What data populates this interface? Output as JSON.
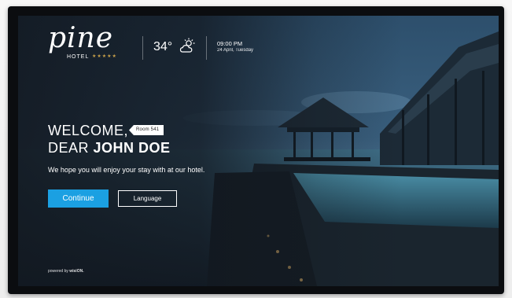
{
  "header": {
    "logo_word": "pine",
    "logo_sub": "HOTEL",
    "logo_stars": "★★★★★",
    "temperature": "34°",
    "weather_icon": "partly-cloudy-icon",
    "time": "09:00 PM",
    "date": "24 April, Tuesday"
  },
  "welcome": {
    "line1": "WELCOME,",
    "line2_prefix": "DEAR ",
    "guest_name": "JOHN DOE",
    "room_tag": "Room 541",
    "message": "We hope you will enjoy your stay with at our hotel."
  },
  "actions": {
    "continue_label": "Continue",
    "language_label": "Language"
  },
  "footer": {
    "powered_prefix": "powered by ",
    "powered_brand": "wisiON."
  },
  "colors": {
    "accent": "#1ba0e2",
    "gold": "#c9a14a"
  }
}
